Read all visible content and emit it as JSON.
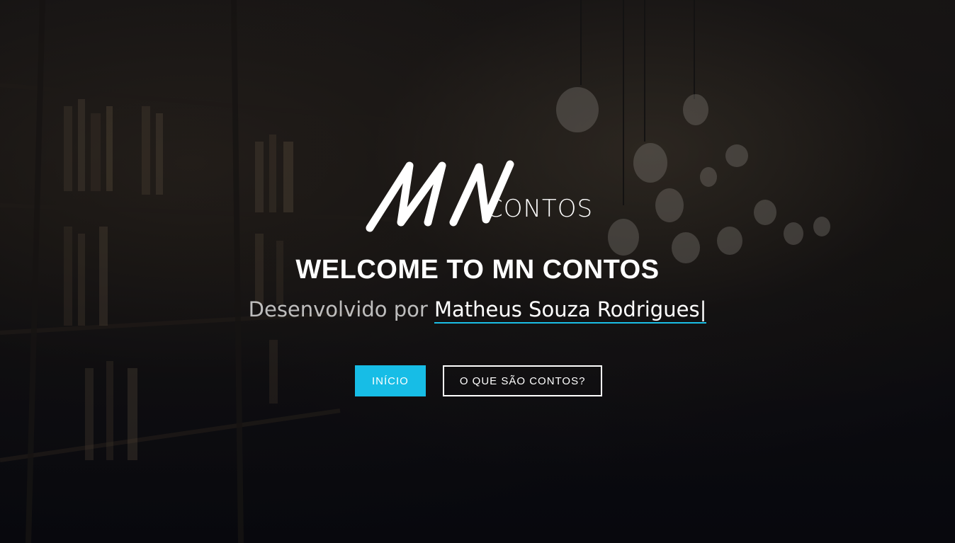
{
  "logo": {
    "monogram": "MN",
    "wordmark": "CONTOS"
  },
  "hero": {
    "title": "WELCOME TO MN CONTOS",
    "subtitle_prefix": "Desenvolvido por",
    "subtitle_name": "Matheus Souza Rodrigues",
    "cursor": "|"
  },
  "buttons": {
    "primary_label": "INÍCIO",
    "secondary_label": "O QUE SÃO CONTOS?"
  },
  "colors": {
    "accent": "#17bde6",
    "text": "#ffffff",
    "background": "#0b0c10"
  }
}
